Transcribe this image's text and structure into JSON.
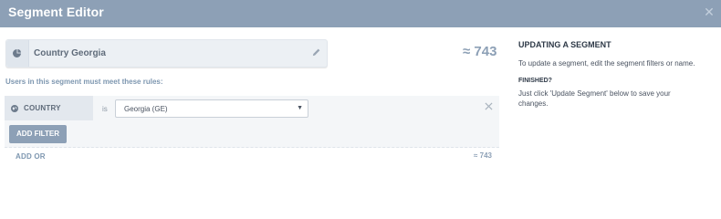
{
  "header": {
    "title": "Segment Editor",
    "close_icon": "close-icon"
  },
  "segment": {
    "name": "Country Georgia",
    "count": "≈ 743",
    "rules_label": "Users in this segment must meet these rules:",
    "rule": {
      "field": "COUNTRY",
      "operator": "is",
      "value": "Georgia (GE)"
    },
    "add_filter_label": "ADD FILTER",
    "add_or_label": "ADD OR",
    "footer_count": "≈ 743"
  },
  "help": {
    "title": "UPDATING A SEGMENT",
    "text": "To update a segment, edit the segment filters or name.",
    "subtitle": "FINISHED?",
    "text2": "Just click 'Update Segment' below to save your changes."
  },
  "colors": {
    "header_bg": "#8da0b6",
    "accent": "#8da0b6",
    "label": "#7e97b0"
  }
}
